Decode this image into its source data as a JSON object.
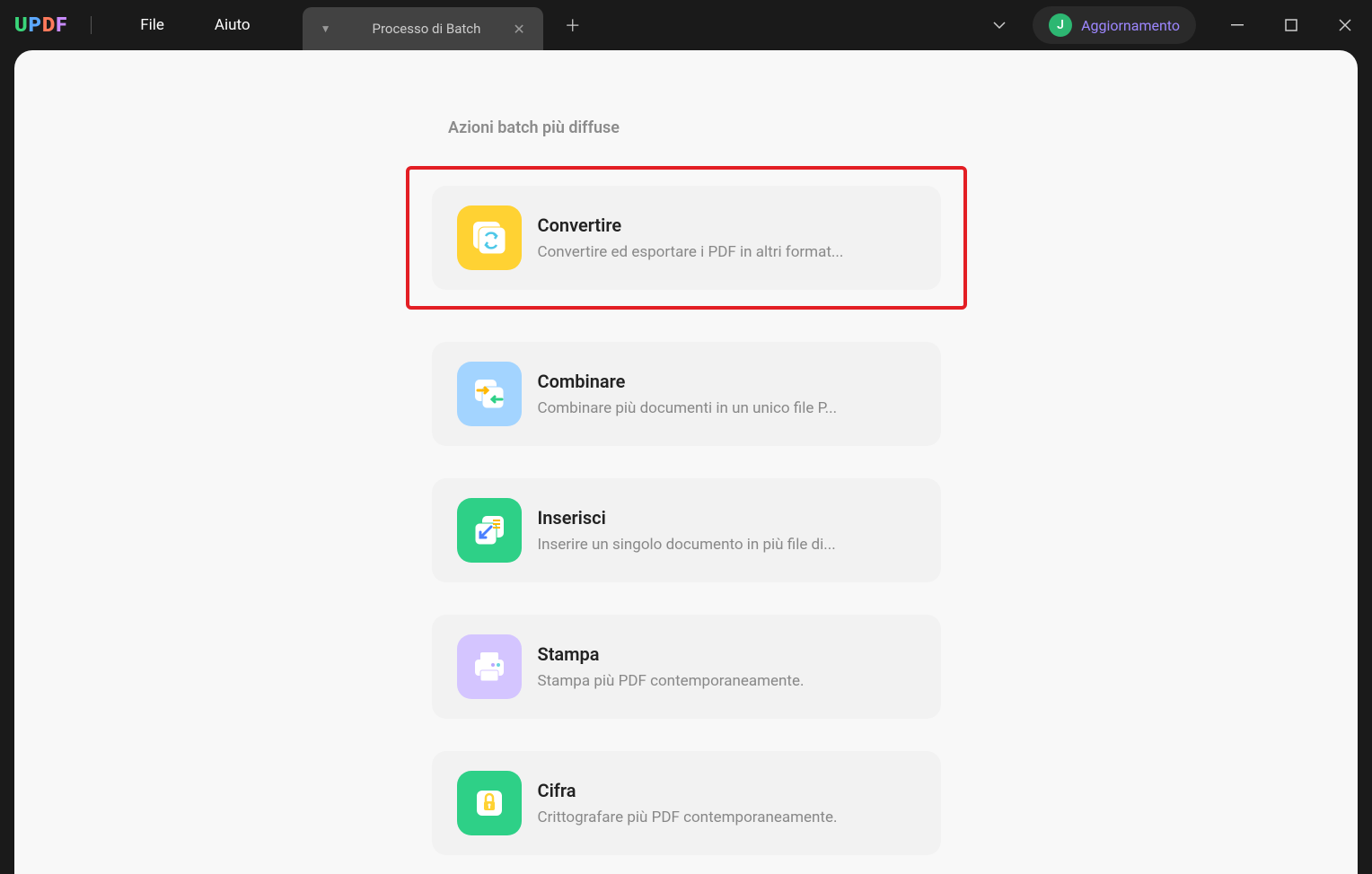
{
  "header": {
    "logo_u": "U",
    "logo_p": "P",
    "logo_d": "D",
    "logo_f": "F",
    "menu_file": "File",
    "menu_help": "Aiuto",
    "tab_title": "Processo di Batch",
    "user_initial": "J",
    "user_label": "Aggiornamento"
  },
  "section": {
    "title": "Azioni batch più diffuse"
  },
  "cards": {
    "convert": {
      "title": "Convertire",
      "desc": "Convertire ed esportare i PDF in altri format..."
    },
    "combine": {
      "title": "Combinare",
      "desc": "Combinare più documenti in un unico file P..."
    },
    "insert": {
      "title": "Inserisci",
      "desc": "Inserire un singolo documento in più file di..."
    },
    "print": {
      "title": "Stampa",
      "desc": "Stampa più PDF contemporaneamente."
    },
    "encrypt": {
      "title": "Cifra",
      "desc": "Crittografare più PDF contemporaneamente."
    }
  }
}
